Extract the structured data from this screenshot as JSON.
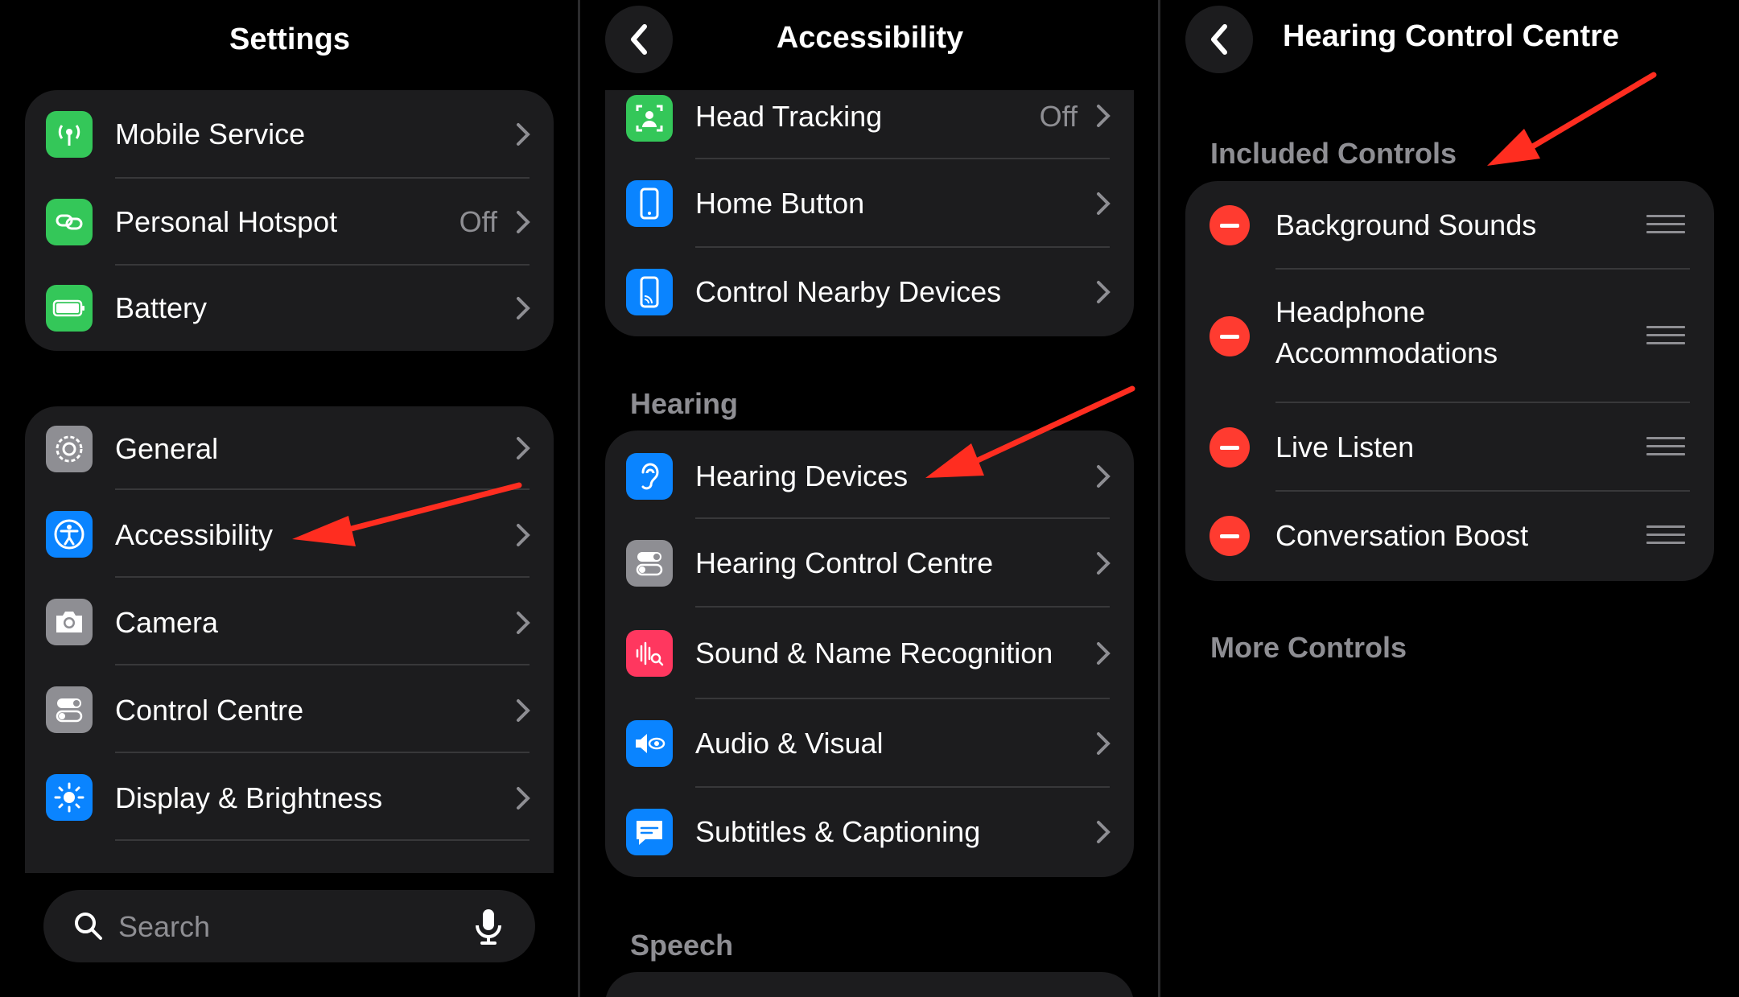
{
  "colors": {
    "accent_red": "#ff2d20",
    "group_bg": "#1c1c1e",
    "secondary_text": "#8e8e93"
  },
  "panel1": {
    "title": "Settings",
    "group1": [
      {
        "label": "Mobile Service",
        "icon": "antenna-icon",
        "color": "#34c759"
      },
      {
        "label": "Personal Hotspot",
        "value": "Off",
        "icon": "link-icon",
        "color": "#34c759"
      },
      {
        "label": "Battery",
        "icon": "battery-icon",
        "color": "#34c759"
      }
    ],
    "group2": [
      {
        "label": "General",
        "icon": "gear-icon",
        "color": "#8e8e93"
      },
      {
        "label": "Accessibility",
        "icon": "accessibility-icon",
        "color": "#0a84ff"
      },
      {
        "label": "Camera",
        "icon": "camera-icon",
        "color": "#8e8e93"
      },
      {
        "label": "Control Centre",
        "icon": "toggles-icon",
        "color": "#8e8e93"
      },
      {
        "label": "Display & Brightness",
        "icon": "sun-icon",
        "color": "#0a84ff"
      }
    ],
    "search": {
      "placeholder": "Search"
    }
  },
  "panel2": {
    "title": "Accessibility",
    "group1": [
      {
        "label": "Head Tracking",
        "value": "Off",
        "icon": "head-tracking-icon",
        "color": "#34c759"
      },
      {
        "label": "Home Button",
        "icon": "home-button-icon",
        "color": "#0a84ff"
      },
      {
        "label": "Control Nearby Devices",
        "icon": "nearby-devices-icon",
        "color": "#0a84ff"
      }
    ],
    "section_hearing": "Hearing",
    "group2": [
      {
        "label": "Hearing Devices",
        "icon": "ear-icon",
        "color": "#0a84ff"
      },
      {
        "label": "Hearing Control Centre",
        "icon": "toggles-icon",
        "color": "#8e8e93"
      },
      {
        "label": "Sound & Name Recognition",
        "icon": "waveform-icon",
        "color": "#ff375f"
      },
      {
        "label": "Audio & Visual",
        "icon": "speaker-eye-icon",
        "color": "#0a84ff"
      },
      {
        "label": "Subtitles & Captioning",
        "icon": "caption-icon",
        "color": "#0a84ff"
      }
    ],
    "section_speech": "Speech"
  },
  "panel3": {
    "title": "Hearing Control Centre",
    "section_included": "Included Controls",
    "controls": [
      {
        "label": "Background Sounds"
      },
      {
        "label": "Headphone",
        "label2": "Accommodations"
      },
      {
        "label": "Live Listen"
      },
      {
        "label": "Conversation Boost"
      }
    ],
    "section_more": "More Controls"
  }
}
